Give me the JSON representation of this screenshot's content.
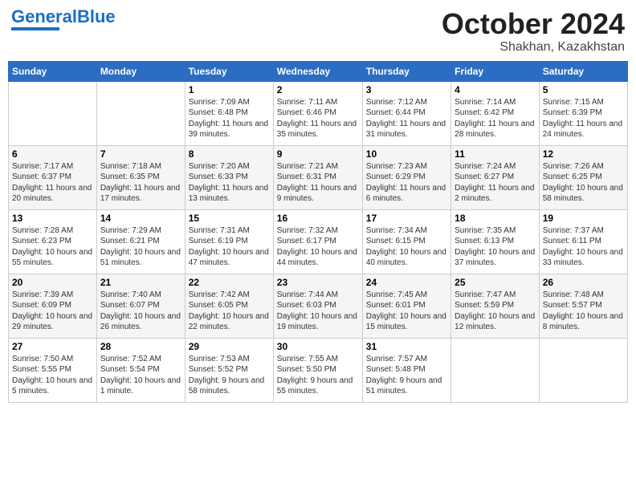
{
  "logo": {
    "general": "General",
    "blue": "Blue"
  },
  "header": {
    "month": "October 2024",
    "location": "Shakhan, Kazakhstan"
  },
  "weekdays": [
    "Sunday",
    "Monday",
    "Tuesday",
    "Wednesday",
    "Thursday",
    "Friday",
    "Saturday"
  ],
  "weeks": [
    [
      {
        "day": "",
        "info": ""
      },
      {
        "day": "",
        "info": ""
      },
      {
        "day": "1",
        "info": "Sunrise: 7:09 AM\nSunset: 6:48 PM\nDaylight: 11 hours and 39 minutes."
      },
      {
        "day": "2",
        "info": "Sunrise: 7:11 AM\nSunset: 6:46 PM\nDaylight: 11 hours and 35 minutes."
      },
      {
        "day": "3",
        "info": "Sunrise: 7:12 AM\nSunset: 6:44 PM\nDaylight: 11 hours and 31 minutes."
      },
      {
        "day": "4",
        "info": "Sunrise: 7:14 AM\nSunset: 6:42 PM\nDaylight: 11 hours and 28 minutes."
      },
      {
        "day": "5",
        "info": "Sunrise: 7:15 AM\nSunset: 6:39 PM\nDaylight: 11 hours and 24 minutes."
      }
    ],
    [
      {
        "day": "6",
        "info": "Sunrise: 7:17 AM\nSunset: 6:37 PM\nDaylight: 11 hours and 20 minutes."
      },
      {
        "day": "7",
        "info": "Sunrise: 7:18 AM\nSunset: 6:35 PM\nDaylight: 11 hours and 17 minutes."
      },
      {
        "day": "8",
        "info": "Sunrise: 7:20 AM\nSunset: 6:33 PM\nDaylight: 11 hours and 13 minutes."
      },
      {
        "day": "9",
        "info": "Sunrise: 7:21 AM\nSunset: 6:31 PM\nDaylight: 11 hours and 9 minutes."
      },
      {
        "day": "10",
        "info": "Sunrise: 7:23 AM\nSunset: 6:29 PM\nDaylight: 11 hours and 6 minutes."
      },
      {
        "day": "11",
        "info": "Sunrise: 7:24 AM\nSunset: 6:27 PM\nDaylight: 11 hours and 2 minutes."
      },
      {
        "day": "12",
        "info": "Sunrise: 7:26 AM\nSunset: 6:25 PM\nDaylight: 10 hours and 58 minutes."
      }
    ],
    [
      {
        "day": "13",
        "info": "Sunrise: 7:28 AM\nSunset: 6:23 PM\nDaylight: 10 hours and 55 minutes."
      },
      {
        "day": "14",
        "info": "Sunrise: 7:29 AM\nSunset: 6:21 PM\nDaylight: 10 hours and 51 minutes."
      },
      {
        "day": "15",
        "info": "Sunrise: 7:31 AM\nSunset: 6:19 PM\nDaylight: 10 hours and 47 minutes."
      },
      {
        "day": "16",
        "info": "Sunrise: 7:32 AM\nSunset: 6:17 PM\nDaylight: 10 hours and 44 minutes."
      },
      {
        "day": "17",
        "info": "Sunrise: 7:34 AM\nSunset: 6:15 PM\nDaylight: 10 hours and 40 minutes."
      },
      {
        "day": "18",
        "info": "Sunrise: 7:35 AM\nSunset: 6:13 PM\nDaylight: 10 hours and 37 minutes."
      },
      {
        "day": "19",
        "info": "Sunrise: 7:37 AM\nSunset: 6:11 PM\nDaylight: 10 hours and 33 minutes."
      }
    ],
    [
      {
        "day": "20",
        "info": "Sunrise: 7:39 AM\nSunset: 6:09 PM\nDaylight: 10 hours and 29 minutes."
      },
      {
        "day": "21",
        "info": "Sunrise: 7:40 AM\nSunset: 6:07 PM\nDaylight: 10 hours and 26 minutes."
      },
      {
        "day": "22",
        "info": "Sunrise: 7:42 AM\nSunset: 6:05 PM\nDaylight: 10 hours and 22 minutes."
      },
      {
        "day": "23",
        "info": "Sunrise: 7:44 AM\nSunset: 6:03 PM\nDaylight: 10 hours and 19 minutes."
      },
      {
        "day": "24",
        "info": "Sunrise: 7:45 AM\nSunset: 6:01 PM\nDaylight: 10 hours and 15 minutes."
      },
      {
        "day": "25",
        "info": "Sunrise: 7:47 AM\nSunset: 5:59 PM\nDaylight: 10 hours and 12 minutes."
      },
      {
        "day": "26",
        "info": "Sunrise: 7:48 AM\nSunset: 5:57 PM\nDaylight: 10 hours and 8 minutes."
      }
    ],
    [
      {
        "day": "27",
        "info": "Sunrise: 7:50 AM\nSunset: 5:55 PM\nDaylight: 10 hours and 5 minutes."
      },
      {
        "day": "28",
        "info": "Sunrise: 7:52 AM\nSunset: 5:54 PM\nDaylight: 10 hours and 1 minute."
      },
      {
        "day": "29",
        "info": "Sunrise: 7:53 AM\nSunset: 5:52 PM\nDaylight: 9 hours and 58 minutes."
      },
      {
        "day": "30",
        "info": "Sunrise: 7:55 AM\nSunset: 5:50 PM\nDaylight: 9 hours and 55 minutes."
      },
      {
        "day": "31",
        "info": "Sunrise: 7:57 AM\nSunset: 5:48 PM\nDaylight: 9 hours and 51 minutes."
      },
      {
        "day": "",
        "info": ""
      },
      {
        "day": "",
        "info": ""
      }
    ]
  ]
}
